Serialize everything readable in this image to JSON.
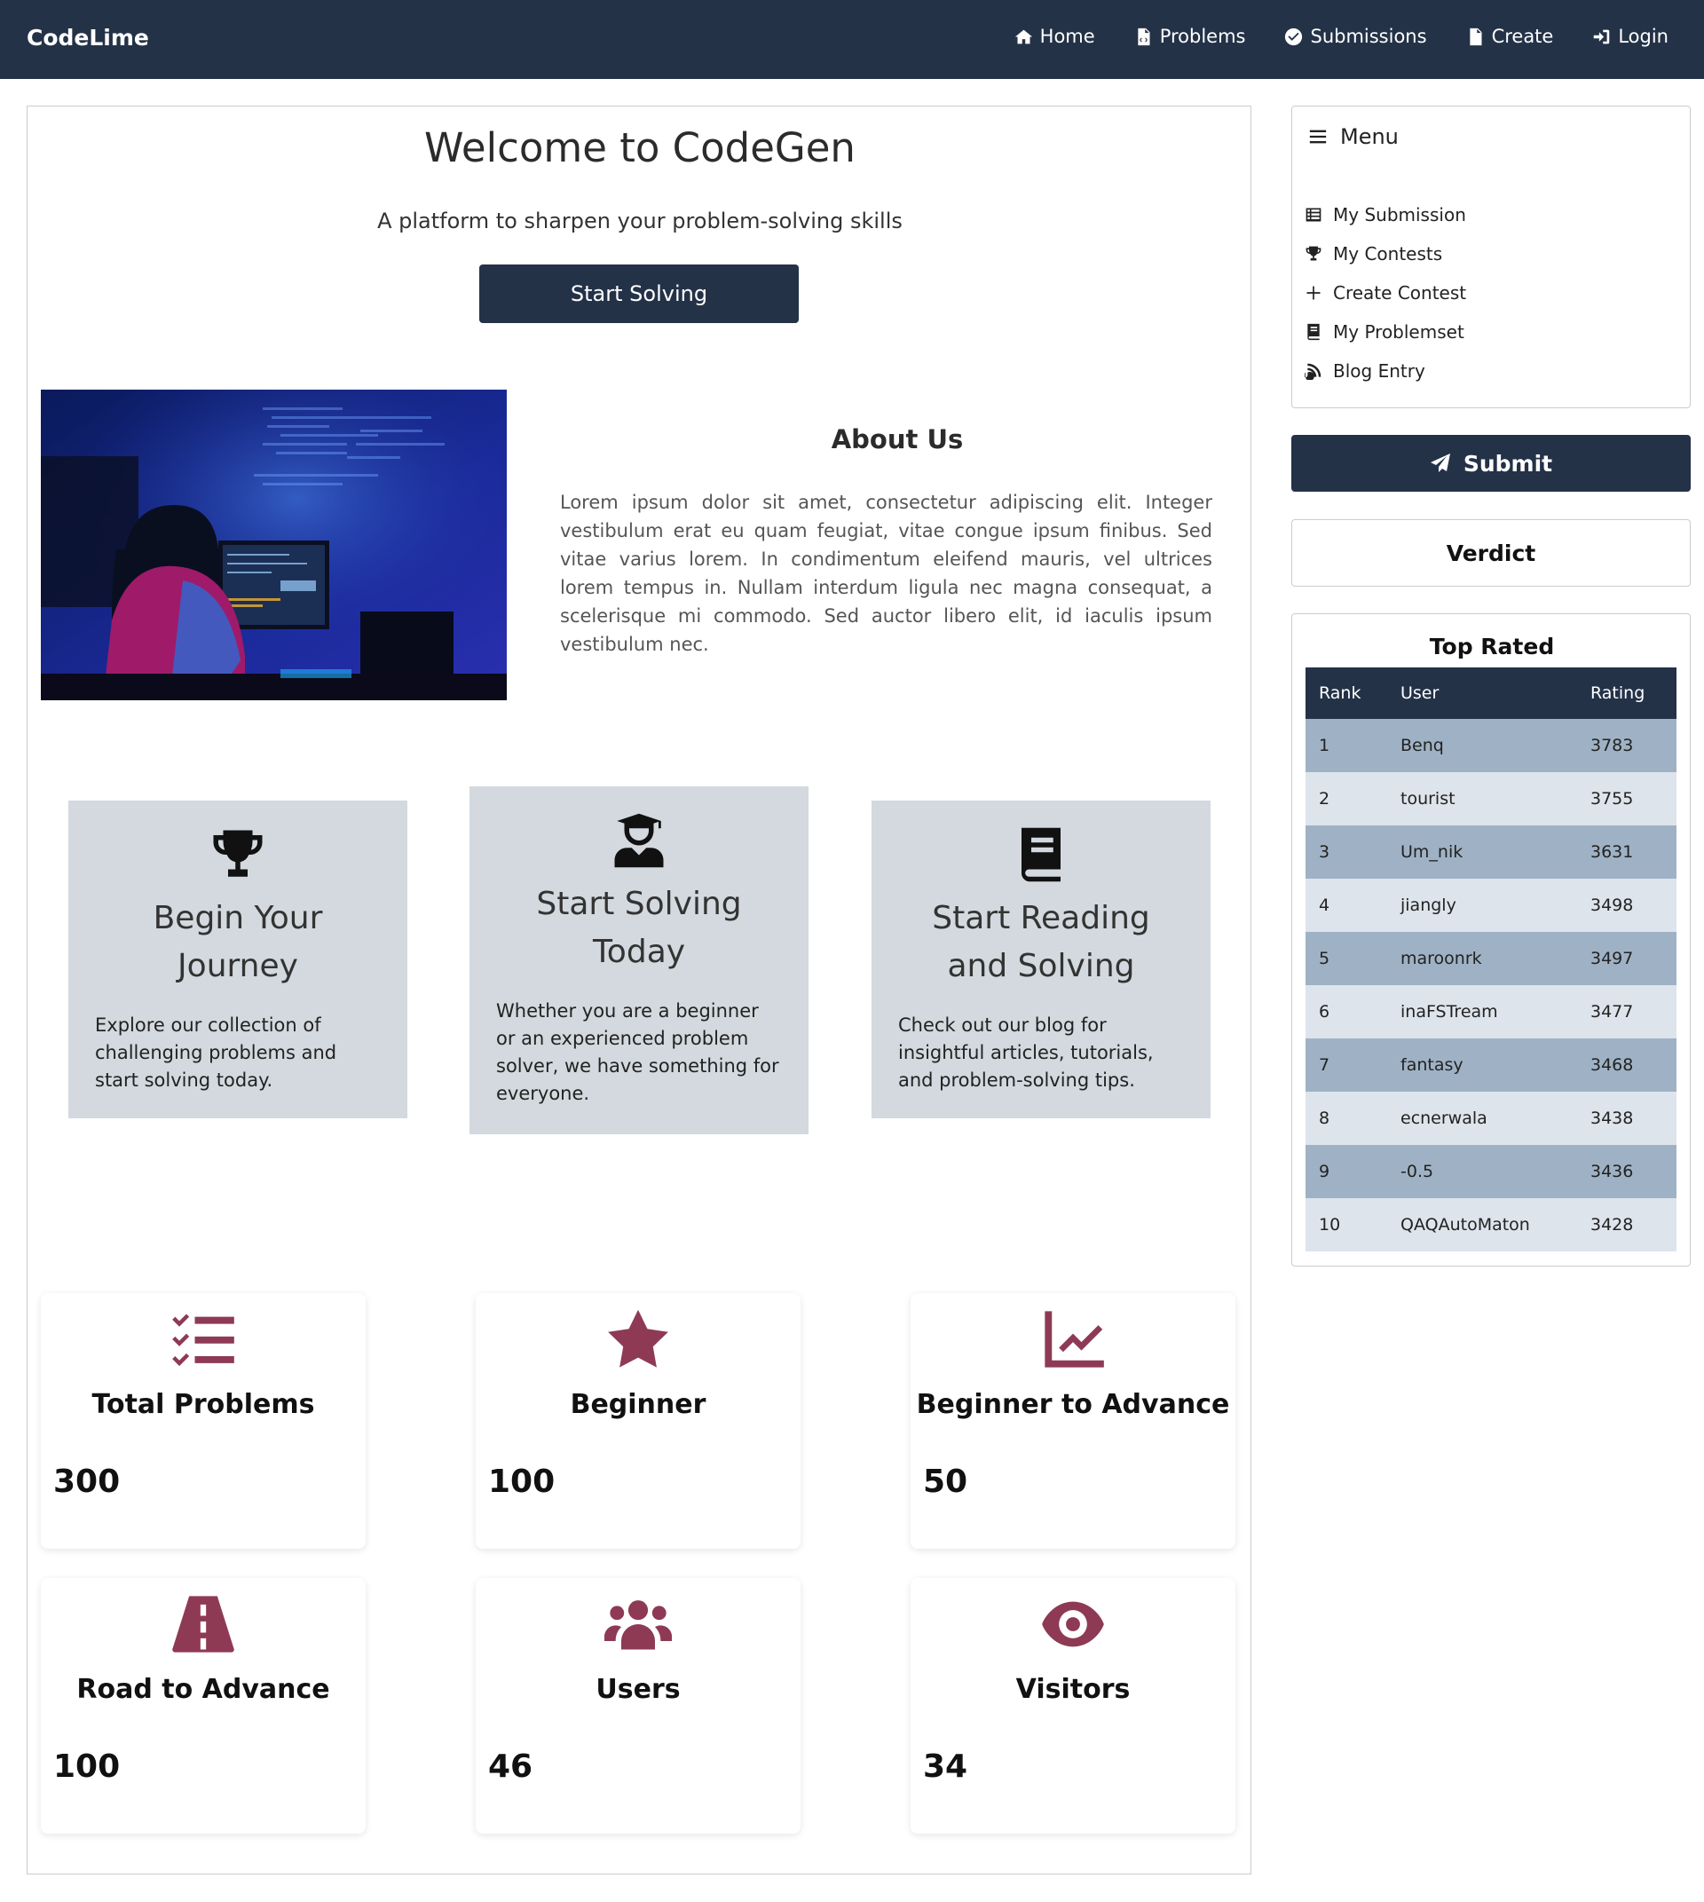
{
  "navbar": {
    "brand": "CodeLime",
    "links": [
      {
        "label": "Home",
        "icon": "home-icon"
      },
      {
        "label": "Problems",
        "icon": "file-code-icon"
      },
      {
        "label": "Submissions",
        "icon": "check-circle-icon"
      },
      {
        "label": "Create",
        "icon": "file-icon"
      },
      {
        "label": "Login",
        "icon": "sign-in-icon"
      }
    ]
  },
  "hero": {
    "title": "Welcome to CodeGen",
    "subtitle": "A platform to sharpen your problem-solving skills",
    "button": "Start Solving"
  },
  "about": {
    "title": "About Us",
    "text": "Lorem ipsum dolor sit amet, consectetur adipiscing elit. Integer vestibulum erat eu quam feugiat, vitae congue ipsum finibus. Sed vitae varius lorem. In condimentum eleifend mauris, vel ultrices lorem tempus in. Nullam interdum ligula nec magna consequat, a scelerisque mi commodo. Sed auctor libero elit, id iaculis ipsum vestibulum nec.",
    "image": "person-at-computer-photo"
  },
  "features": [
    {
      "icon": "trophy-icon",
      "title": "Begin Your Journey",
      "text": "Explore our collection of challenging problems and start solving today."
    },
    {
      "icon": "user-graduate-icon",
      "title": "Start Solving Today",
      "text": "Whether you are a beginner or an experienced problem solver, we have something for everyone."
    },
    {
      "icon": "book-icon",
      "title": "Start Reading and Solving",
      "text": "Check out our blog for insightful articles, tutorials, and problem-solving tips."
    }
  ],
  "stats": [
    {
      "icon": "list-check-icon",
      "label": "Total Problems",
      "value": "300"
    },
    {
      "icon": "star-icon",
      "label": "Beginner",
      "value": "100"
    },
    {
      "icon": "chart-line-icon",
      "label": "Beginner to Advance",
      "value": "50"
    },
    {
      "icon": "road-icon",
      "label": "Road to Advance",
      "value": "100"
    },
    {
      "icon": "users-icon",
      "label": "Users",
      "value": "46"
    },
    {
      "icon": "eye-icon",
      "label": "Visitors",
      "value": "34"
    }
  ],
  "sidebar": {
    "menu_title": "Menu",
    "items": [
      {
        "label": "My Submission",
        "icon": "table-list-icon"
      },
      {
        "label": "My Contests",
        "icon": "trophy-icon"
      },
      {
        "label": "Create Contest",
        "icon": "plus-icon"
      },
      {
        "label": "My Problemset",
        "icon": "book-icon"
      },
      {
        "label": "Blog Entry",
        "icon": "blog-icon"
      }
    ],
    "submit_label": "Submit",
    "verdict_label": "Verdict"
  },
  "top_rated": {
    "title": "Top Rated",
    "columns": [
      "Rank",
      "User",
      "Rating"
    ],
    "rows": [
      [
        "1",
        "Benq",
        "3783"
      ],
      [
        "2",
        "tourist",
        "3755"
      ],
      [
        "3",
        "Um_nik",
        "3631"
      ],
      [
        "4",
        "jiangly",
        "3498"
      ],
      [
        "5",
        "maroonrk",
        "3497"
      ],
      [
        "6",
        "inaFSTream",
        "3477"
      ],
      [
        "7",
        "fantasy",
        "3468"
      ],
      [
        "8",
        "ecnerwala",
        "3438"
      ],
      [
        "9",
        "-0.5",
        "3436"
      ],
      [
        "10",
        "QAQAutoMaton",
        "3428"
      ]
    ]
  }
}
